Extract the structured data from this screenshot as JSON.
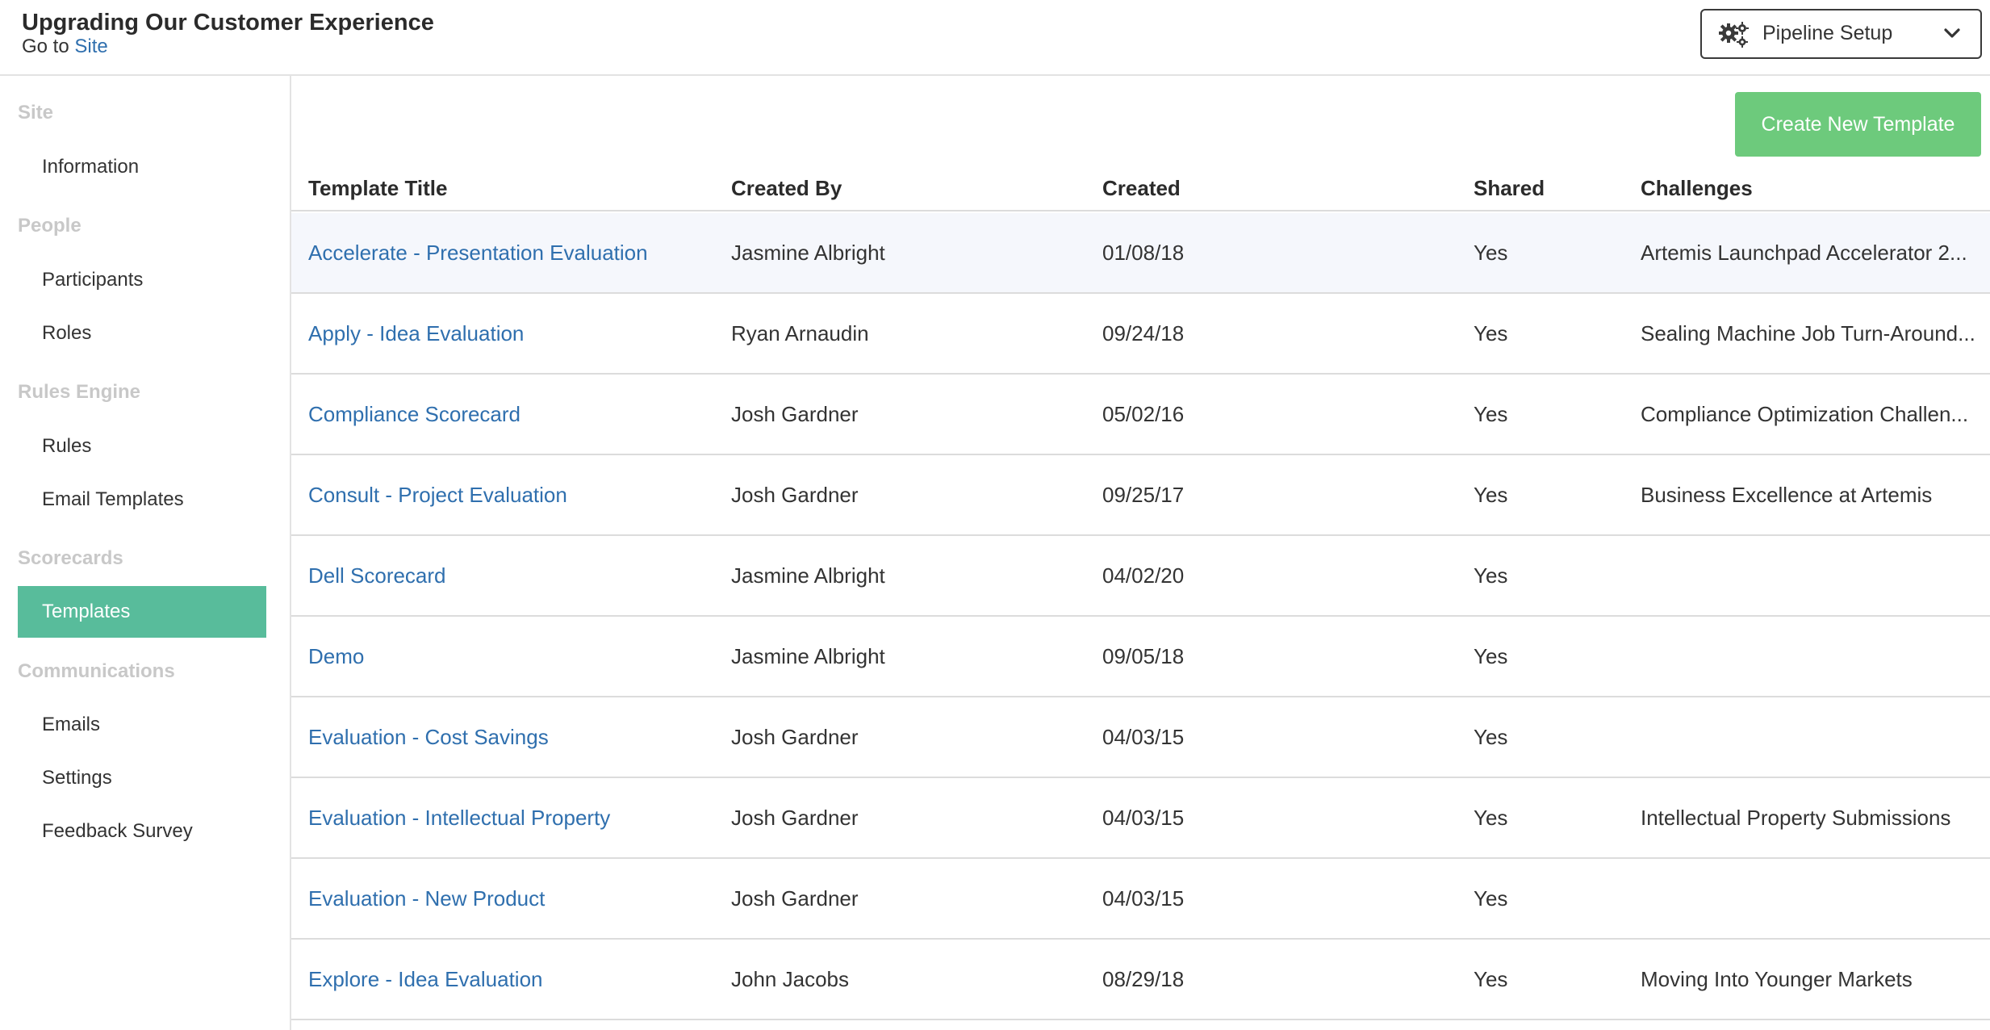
{
  "header": {
    "site_title": "Upgrading Our Customer Experience",
    "goto_prefix": "Go to",
    "goto_link": "Site",
    "dropdown": {
      "label": "Pipeline Setup",
      "icon": "gears-icon",
      "chevron": "chevron-down-icon"
    }
  },
  "sidebar": {
    "groups": [
      {
        "label": "Site",
        "items": [
          "Information"
        ]
      },
      {
        "label": "People",
        "items": [
          "Participants",
          "Roles"
        ]
      },
      {
        "label": "Rules Engine",
        "items": [
          "Rules",
          "Email Templates"
        ]
      },
      {
        "label": "Scorecards",
        "items": [
          "Templates"
        ]
      },
      {
        "label": "Communications",
        "items": [
          "Emails",
          "Settings",
          "Feedback Survey"
        ]
      }
    ],
    "active_item": "Templates"
  },
  "toolbar": {
    "create_label": "Create New Template"
  },
  "table": {
    "columns": [
      "Template Title",
      "Created By",
      "Created",
      "Shared",
      "Challenges"
    ],
    "rows": [
      {
        "title": "Accelerate - Presentation Evaluation",
        "created_by": "Jasmine Albright",
        "created": "01/08/18",
        "shared": "Yes",
        "challenges": "Artemis Launchpad Accelerator 2..."
      },
      {
        "title": "Apply - Idea Evaluation",
        "created_by": "Ryan Arnaudin",
        "created": "09/24/18",
        "shared": "Yes",
        "challenges": "Sealing Machine Job Turn-Around..."
      },
      {
        "title": "Compliance Scorecard",
        "created_by": "Josh Gardner",
        "created": "05/02/16",
        "shared": "Yes",
        "challenges": "Compliance Optimization Challen..."
      },
      {
        "title": "Consult - Project Evaluation",
        "created_by": "Josh Gardner",
        "created": "09/25/17",
        "shared": "Yes",
        "challenges": "Business Excellence at Artemis"
      },
      {
        "title": "Dell Scorecard",
        "created_by": "Jasmine Albright",
        "created": "04/02/20",
        "shared": "Yes",
        "challenges": ""
      },
      {
        "title": "Demo",
        "created_by": "Jasmine Albright",
        "created": "09/05/18",
        "shared": "Yes",
        "challenges": ""
      },
      {
        "title": "Evaluation - Cost Savings",
        "created_by": "Josh Gardner",
        "created": "04/03/15",
        "shared": "Yes",
        "challenges": ""
      },
      {
        "title": "Evaluation - Intellectual Property",
        "created_by": "Josh Gardner",
        "created": "04/03/15",
        "shared": "Yes",
        "challenges": "Intellectual Property Submissions"
      },
      {
        "title": "Evaluation - New Product",
        "created_by": "Josh Gardner",
        "created": "04/03/15",
        "shared": "Yes",
        "challenges": ""
      },
      {
        "title": "Explore - Idea Evaluation",
        "created_by": "John Jacobs",
        "created": "08/29/18",
        "shared": "Yes",
        "challenges": "Moving Into Younger Markets"
      }
    ]
  },
  "colors": {
    "accent_active": "#58bc9b",
    "create_button": "#6dca7c",
    "link": "#2f6fae",
    "row_highlight": "#f5f7fc"
  }
}
